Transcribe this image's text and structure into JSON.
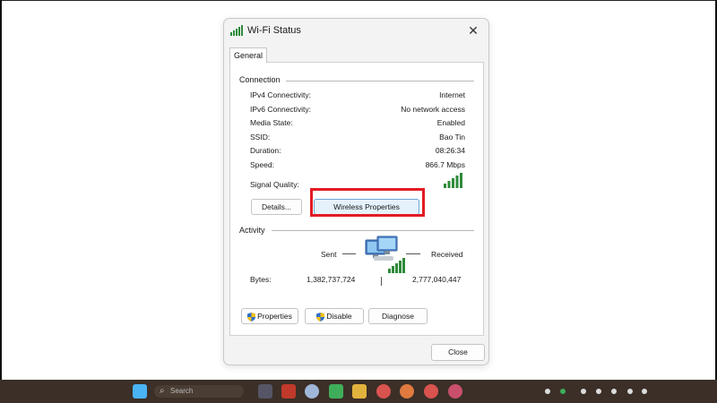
{
  "window": {
    "title": "Wi-Fi Status",
    "close_glyph": "✕",
    "title_icon": "wifi-signal-icon"
  },
  "tabs": [
    {
      "label": "General",
      "selected": true
    }
  ],
  "connection": {
    "group_label": "Connection",
    "rows": [
      {
        "label": "IPv4 Connectivity:",
        "value": "Internet"
      },
      {
        "label": "IPv6 Connectivity:",
        "value": "No network access"
      },
      {
        "label": "Media State:",
        "value": "Enabled"
      },
      {
        "label": "SSID:",
        "value": "Bao Tin"
      },
      {
        "label": "Duration:",
        "value": "08:26:34"
      },
      {
        "label": "Speed:",
        "value": "866.7 Mbps"
      }
    ],
    "signal_quality_label": "Signal Quality:",
    "signal_bars": 5,
    "details_button": "Details...",
    "wireless_button": "Wireless Properties"
  },
  "activity": {
    "group_label": "Activity",
    "sent_label": "Sent",
    "received_label": "Received",
    "bytes_label": "Bytes:",
    "bytes_sent": "1,382,737,724",
    "bytes_received": "2,777,040,447",
    "properties_button": "Properties",
    "disable_button": "Disable",
    "diagnose_button": "Diagnose"
  },
  "footer": {
    "close_button": "Close"
  },
  "colors": {
    "highlight": "#e31b23",
    "signal": "#2e8b3a",
    "accent_button": "#e5f1fb"
  },
  "taskbar": {
    "search_placeholder": "Search"
  }
}
